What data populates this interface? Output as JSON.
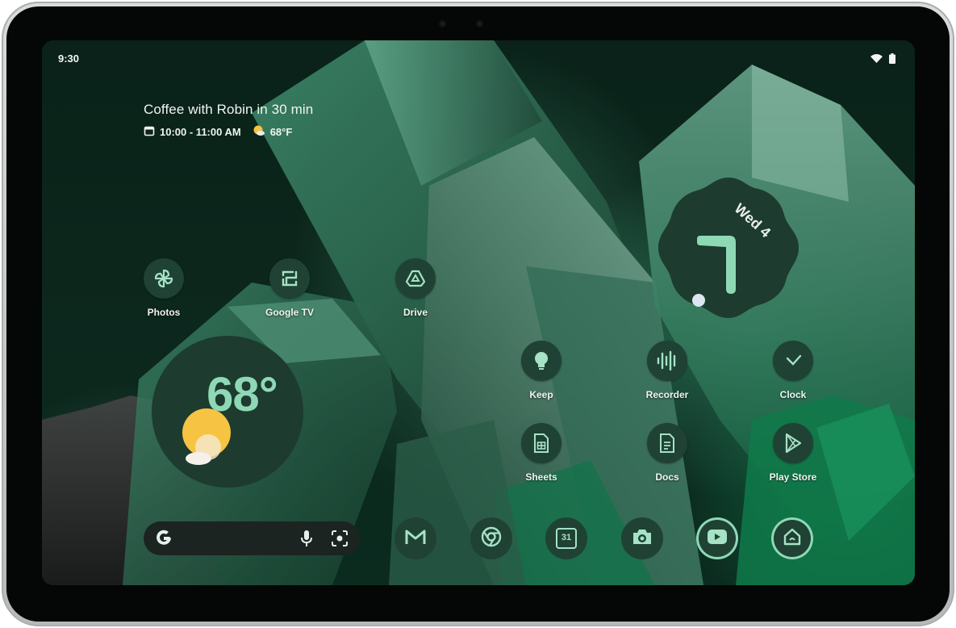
{
  "status_bar": {
    "time": "9:30",
    "icons": [
      "wifi-icon",
      "battery-icon"
    ]
  },
  "at_a_glance": {
    "title": "Coffee with Robin in 30 min",
    "time_range": "10:00 - 11:00 AM",
    "temperature": "68°F",
    "icons": [
      "calendar-icon",
      "weather-sun-icon"
    ]
  },
  "apps_top": [
    {
      "label": "Photos",
      "icon": "pinwheel-icon"
    },
    {
      "label": "Google TV",
      "icon": "google-tv-icon"
    },
    {
      "label": "Drive",
      "icon": "drive-icon"
    }
  ],
  "apps_grid": [
    {
      "label": "Keep",
      "icon": "lightbulb-icon"
    },
    {
      "label": "Recorder",
      "icon": "waveform-icon"
    },
    {
      "label": "Clock",
      "icon": "clock-icon"
    },
    {
      "label": "Sheets",
      "icon": "sheets-icon"
    },
    {
      "label": "Docs",
      "icon": "docs-icon"
    },
    {
      "label": "Play Store",
      "icon": "play-store-icon"
    }
  ],
  "weather_widget": {
    "temperature": "68°",
    "icon": "sun-cloud-icon"
  },
  "clock_widget": {
    "date": "Wed 4"
  },
  "search_bar": {
    "icons": [
      "google-g-icon",
      "mic-icon",
      "lens-icon"
    ]
  },
  "dock": [
    {
      "app": "gmail",
      "icon": "gmail-icon"
    },
    {
      "app": "chrome",
      "icon": "chrome-icon"
    },
    {
      "app": "calendar",
      "icon": "calendar-31-icon",
      "text": "31"
    },
    {
      "app": "camera",
      "icon": "camera-icon"
    },
    {
      "app": "youtube",
      "icon": "youtube-icon"
    },
    {
      "app": "home",
      "icon": "home-icon"
    }
  ],
  "colors": {
    "icon_bg": "#1f4234",
    "icon_fg": "#a6e2c6",
    "accent": "#8fd8b6",
    "wallpaper": "#0b261c",
    "sun": "#f7c343"
  }
}
